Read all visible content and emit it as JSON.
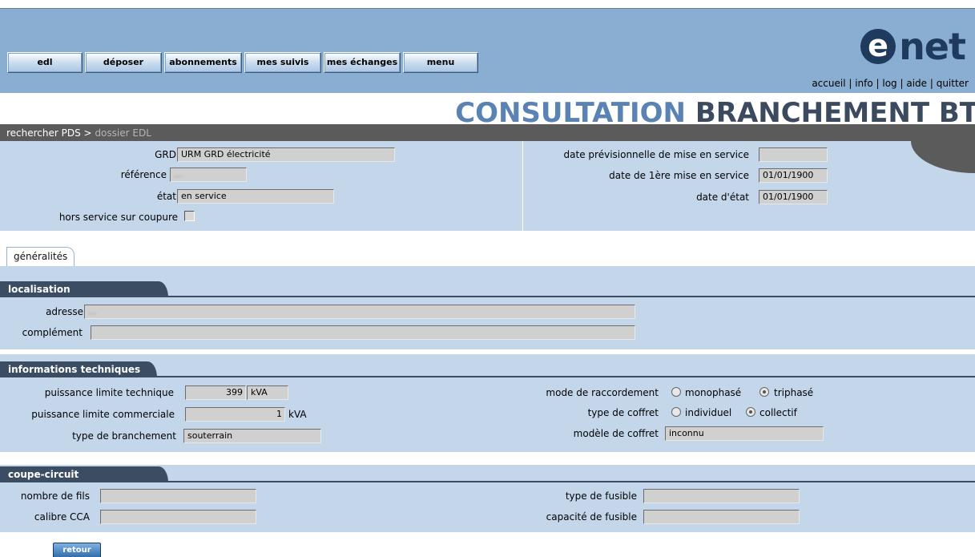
{
  "nav": {
    "buttons": [
      "edl",
      "déposer",
      "abonnements",
      "mes suivis",
      "mes échanges",
      "menu"
    ]
  },
  "logo": {
    "glyph": "e",
    "text": "net"
  },
  "toplinks": "accueil | info | log | aide | quitter",
  "title": {
    "part1": "CONSULTATION",
    "part2": "BRANCHEMENT BT"
  },
  "breadcrumb": {
    "link": "rechercher PDS >",
    "current": "dossier EDL"
  },
  "header": {
    "grd_label": "GRD",
    "grd_value": "URM GRD électricité",
    "reference_label": "référence",
    "reference_value": "...",
    "etat_label": "état",
    "etat_value": "en service",
    "hors_service_label": "hors service sur coupure",
    "date_prev_label": "date prévisionnelle de mise en service",
    "date_prev_value": "",
    "date_first_label": "date de 1ère mise en service",
    "date_first_value": "01/01/1900",
    "date_etat_label": "date d'état",
    "date_etat_value": "01/01/1900"
  },
  "tabs": [
    "généralités"
  ],
  "localisation": {
    "title": "localisation",
    "adresse_label": "adresse",
    "adresse_value": "...",
    "complement_label": "complément",
    "complement_value": ""
  },
  "tech": {
    "title": "informations techniques",
    "plt_label": "puissance limite technique",
    "plt_value": "399",
    "plt_unit": "kVA",
    "plc_label": "puissance limite commerciale",
    "plc_value": "1",
    "plc_unit": "kVA",
    "type_branchement_label": "type de branchement",
    "type_branchement_value": "souterrain",
    "mode_label": "mode de raccordement",
    "mode_options": [
      "monophasé",
      "triphasé"
    ],
    "mode_selected": "triphasé",
    "coffret_label": "type de coffret",
    "coffret_options": [
      "individuel",
      "collectif"
    ],
    "coffret_selected": "collectif",
    "modele_label": "modèle de coffret",
    "modele_value": "inconnu"
  },
  "coupe": {
    "title": "coupe-circuit",
    "nb_fils_label": "nombre de fils",
    "nb_fils_value": "",
    "calibre_label": "calibre CCA",
    "calibre_value": "",
    "type_fusible_label": "type de fusible",
    "type_fusible_value": "",
    "capacite_label": "capacité de fusible",
    "capacite_value": ""
  },
  "retour_label": "retour",
  "colors": {
    "topbar": "#89aed1",
    "panel": "#c3d6ea",
    "section_header": "#3b4d63",
    "title_light": "#5a83b4",
    "title_dark": "#3b4a5e"
  }
}
